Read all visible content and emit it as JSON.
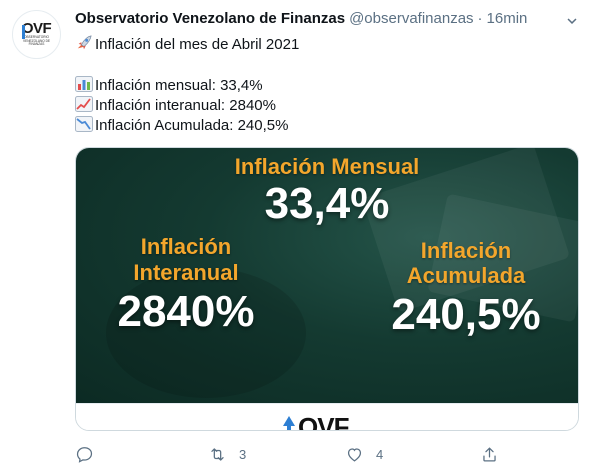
{
  "tweet": {
    "author_name": "Observatorio Venezolano de Finanzas",
    "handle": "@observafinanzas",
    "separator": "·",
    "time": "16min",
    "avatar": {
      "logo_text": "OVF",
      "logo_subtext": "OBSERVATORIO VENEZOLANO DE FINANZAS"
    },
    "lines": [
      {
        "icon": "rocket-emoji",
        "text": "Inflación del mes de Abril 2021"
      },
      {
        "icon": "bar-chart-emoji",
        "text": "Inflación mensual: 33,4%"
      },
      {
        "icon": "chart-increasing-emoji",
        "text": "Inflación interanual: 2840%"
      },
      {
        "icon": "chart-decreasing-emoji",
        "text": "Inflación Acumulada: 240,5%"
      }
    ],
    "media": {
      "monthly_label": "Inflación Mensual",
      "monthly_value": "33,4%",
      "yearly_label_1": "Inflación",
      "yearly_label_2": "Interanual",
      "yearly_value": "2840%",
      "accum_label_1": "Inflación",
      "accum_label_2": "Acumulada",
      "accum_value": "240,5%",
      "footer_logo": "OVF",
      "colors": {
        "label": "#f3a62c",
        "value": "#ffffff",
        "background": "#143a31"
      }
    },
    "actions": {
      "reply_count": "",
      "retweet_count": "3",
      "like_count": "4"
    }
  }
}
